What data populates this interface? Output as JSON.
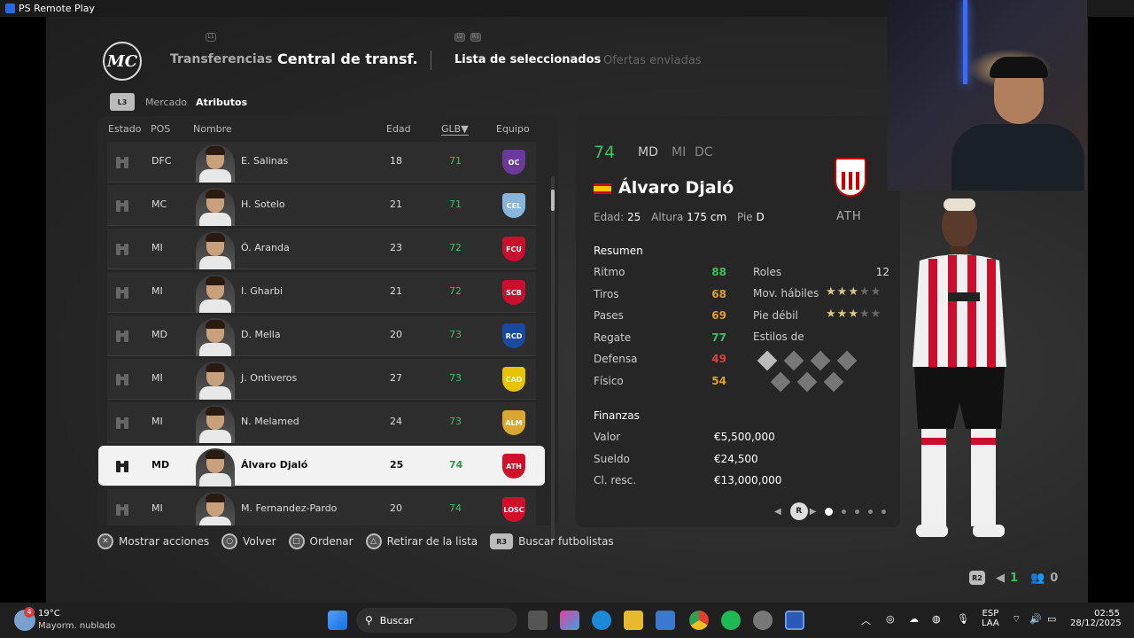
{
  "window": {
    "title": "PS Remote Play"
  },
  "header": {
    "tab_transfers": "Transferencias",
    "tab_central": "Central de transf.",
    "tab_shortlist": "Lista de seleccionados",
    "tab_offers": "Ofertas enviadas",
    "hint_l1": "L1",
    "hint_l2": "L2",
    "hint_r1": "R1"
  },
  "subtabs": {
    "l3": "L3",
    "market": "Mercado",
    "attributes": "Atributos"
  },
  "table": {
    "headers": {
      "estado": "Estado",
      "pos": "POS",
      "nombre": "Nombre",
      "edad": "Edad",
      "glb": "GLB▼",
      "equipo": "Equipo"
    },
    "rows": [
      {
        "pos": "DFC",
        "name": "E. Salinas",
        "age": "18",
        "glb": "71",
        "badge_color": "#6a3a9a",
        "badge_text": "OC"
      },
      {
        "pos": "MC",
        "name": "H. Sotelo",
        "age": "21",
        "glb": "71",
        "badge_color": "#8ab4d8",
        "badge_text": "CEL"
      },
      {
        "pos": "MI",
        "name": "Ó. Aranda",
        "age": "23",
        "glb": "72",
        "badge_color": "#c8102e",
        "badge_text": "FCU"
      },
      {
        "pos": "MI",
        "name": "I. Gharbi",
        "age": "21",
        "glb": "72",
        "badge_color": "#c8102e",
        "badge_text": "SCB"
      },
      {
        "pos": "MD",
        "name": "D. Mella",
        "age": "20",
        "glb": "73",
        "badge_color": "#1a4aa0",
        "badge_text": "RCD"
      },
      {
        "pos": "MI",
        "name": "J. Ontiveros",
        "age": "27",
        "glb": "73",
        "badge_color": "#e8c400",
        "badge_text": "CAD"
      },
      {
        "pos": "MI",
        "name": "N. Melamed",
        "age": "24",
        "glb": "73",
        "badge_color": "#d8a830",
        "badge_text": "ALM"
      },
      {
        "pos": "MD",
        "name": "Álvaro Djaló",
        "age": "25",
        "glb": "74",
        "badge_color": "#d0102a",
        "badge_text": "ATH",
        "selected": true
      },
      {
        "pos": "MI",
        "name": "M. Fernandez-Pardo",
        "age": "20",
        "glb": "74",
        "badge_color": "#d0102a",
        "badge_text": "LOSC"
      }
    ]
  },
  "player": {
    "rating": "74",
    "positions": [
      "MD",
      "MI",
      "DC"
    ],
    "name": "Álvaro Djaló",
    "age_label": "Edad:",
    "age": "25",
    "height_label": "Altura",
    "height": "175 cm",
    "foot_label": "Pie",
    "foot": "D",
    "club": "ATH",
    "summary_title": "Resumen",
    "stats": [
      {
        "label": "Ritmo",
        "value": "88",
        "color": "#3ec05a"
      },
      {
        "label": "Tiros",
        "value": "68",
        "color": "#e0a030"
      },
      {
        "label": "Pases",
        "value": "69",
        "color": "#e0a030"
      },
      {
        "label": "Regate",
        "value": "77",
        "color": "#3ec05a"
      },
      {
        "label": "Defensa",
        "value": "49",
        "color": "#e04040"
      },
      {
        "label": "Físico",
        "value": "54",
        "color": "#e0a030"
      }
    ],
    "roles_label": "Roles",
    "roles_value": "12",
    "skill_moves_label": "Mov. hábiles",
    "skill_moves_stars": 3,
    "weak_foot_label": "Pie débil",
    "weak_foot_stars": 3,
    "playstyles_label": "Estilos de juego",
    "finances_title": "Finanzas",
    "value_label": "Valor",
    "value": "€5,500,000",
    "wage_label": "Sueldo",
    "wage": "€24,500",
    "clause_label": "Cl. resc.",
    "clause": "€13,000,000",
    "pager_r": "R"
  },
  "footer": {
    "show_actions": "Mostrar acciones",
    "back": "Volver",
    "sort": "Ordenar",
    "remove": "Retirar de la lista",
    "search": "Buscar futbolistas",
    "r3": "R3"
  },
  "bottom_right": {
    "r2": "R2",
    "count1": "1",
    "count2": "0"
  },
  "taskbar": {
    "weather_temp": "19°C",
    "weather_desc": "Mayorm. nublado",
    "weather_badge": "4",
    "search": "Buscar",
    "lang1": "ESP",
    "lang2": "LAA",
    "time": "02:55",
    "date": "28/12/2025"
  }
}
